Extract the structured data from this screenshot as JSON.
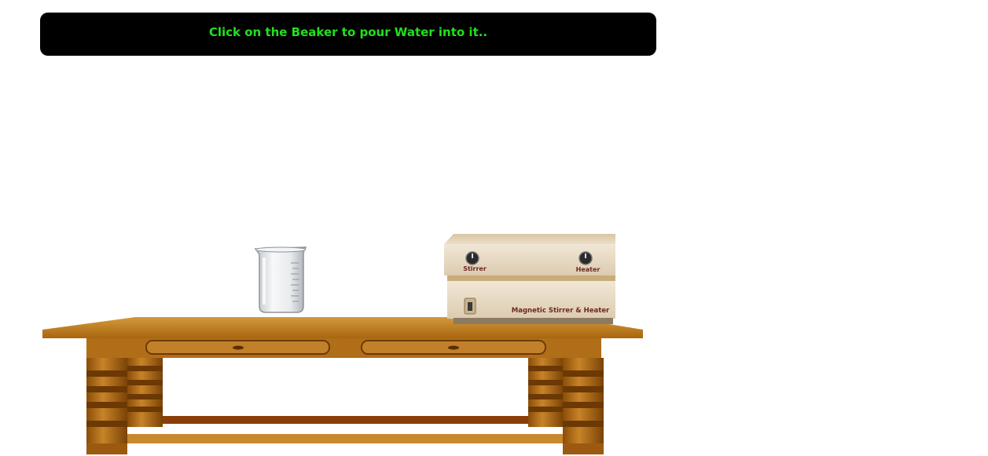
{
  "instruction": {
    "text": "Click on the Beaker to pour Water into it.."
  },
  "device": {
    "stirrer_label": "Stirrer",
    "heater_label": "Heater",
    "name_label": "Magnetic Stirrer & Heater"
  },
  "colors": {
    "instruction_bg": "#000000",
    "instruction_text": "#22e01c",
    "table_wood": "#b8741a",
    "device_body": "#e8dcc6",
    "label_text": "#6b2a22"
  },
  "icons": {
    "beaker": "beaker-icon",
    "stirrer_knob": "knob-icon",
    "heater_knob": "knob-icon",
    "power_switch": "switch-icon"
  }
}
